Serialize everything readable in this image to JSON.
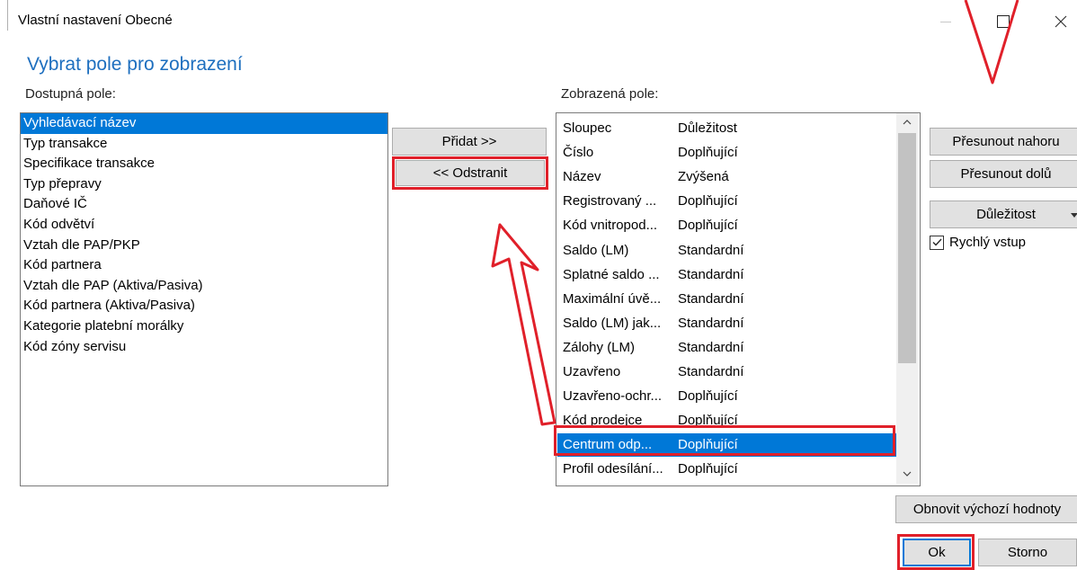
{
  "window": {
    "title": "Vlastní nastavení Obecné"
  },
  "heading": "Vybrat pole pro zobrazení",
  "available": {
    "label": "Dostupná pole:",
    "items": [
      "Vyhledávací název",
      "Typ transakce",
      "Specifikace transakce",
      "Typ přepravy",
      "Daňové IČ",
      "Kód odvětví",
      "Vztah dle PAP/PKP",
      "Kód partnera",
      "Vztah dle PAP (Aktiva/Pasiva)",
      "Kód partnera (Aktiva/Pasiva)",
      "Kategorie platební morálky",
      "Kód zóny servisu"
    ],
    "selected_index": 0
  },
  "buttons": {
    "add": "Přidat >>",
    "remove": "<< Odstranit",
    "move_up": "Přesunout nahoru",
    "move_down": "Přesunout dolů",
    "importance": "Důležitost",
    "reset": "Obnovit výchozí hodnoty",
    "ok": "Ok",
    "cancel": "Storno"
  },
  "quick_entry": {
    "label": "Rychlý vstup",
    "checked": true
  },
  "shown": {
    "label": "Zobrazená pole:",
    "header": {
      "col1": "Sloupec",
      "col2": "Důležitost"
    },
    "rows": [
      {
        "col1": "Číslo",
        "col2": "Doplňující"
      },
      {
        "col1": "Název",
        "col2": "Zvýšená"
      },
      {
        "col1": "Registrovaný ...",
        "col2": "Doplňující"
      },
      {
        "col1": "Kód vnitropod...",
        "col2": "Doplňující"
      },
      {
        "col1": "Saldo (LM)",
        "col2": "Standardní"
      },
      {
        "col1": "Splatné saldo ...",
        "col2": "Standardní"
      },
      {
        "col1": "Maximální úvě...",
        "col2": "Standardní"
      },
      {
        "col1": "Saldo (LM) jak...",
        "col2": "Standardní"
      },
      {
        "col1": "Zálohy (LM)",
        "col2": "Standardní"
      },
      {
        "col1": "Uzavřeno",
        "col2": "Standardní"
      },
      {
        "col1": "Uzavřeno-ochr...",
        "col2": "Doplňující"
      },
      {
        "col1": "Kód prodejce",
        "col2": "Doplňující"
      },
      {
        "col1": "Centrum odp...",
        "col2": "Doplňující"
      },
      {
        "col1": "Profil odesílání...",
        "col2": "Doplňující"
      }
    ],
    "selected_index": 12
  },
  "colors": {
    "accent": "#0078d7",
    "annotation": "#e0202a",
    "heading": "#1e6fbf"
  }
}
